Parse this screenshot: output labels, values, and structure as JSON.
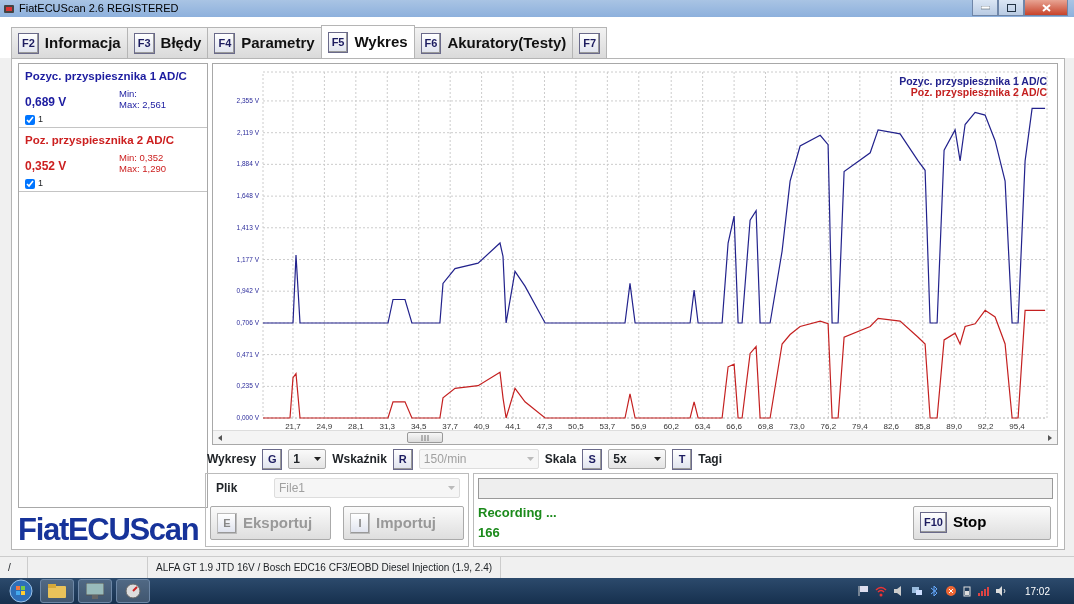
{
  "window": {
    "title": "FiatECUScan 2.6 REGISTERED"
  },
  "tabs": [
    {
      "key": "F2",
      "label": "Informacja",
      "selected": false
    },
    {
      "key": "F3",
      "label": "Błędy",
      "selected": false
    },
    {
      "key": "F4",
      "label": "Parametry",
      "selected": false
    },
    {
      "key": "F5",
      "label": "Wykres",
      "selected": true
    },
    {
      "key": "F6",
      "label": "Akuratory(Testy)",
      "selected": false
    },
    {
      "key": "F7",
      "selected": false
    }
  ],
  "signals": [
    {
      "name": "Pozyc. przyspiesznika 1 AD/C",
      "value": "0,689 V",
      "min": "Min:",
      "max": "Max: 2,561",
      "checkbox_label": "1",
      "checked": true,
      "color": "#1c1ca0"
    },
    {
      "name": "Poz. przyspiesznika 2 AD/C",
      "value": "0,352 V",
      "min": "Min: 0,352",
      "max": "Max: 1,290",
      "checkbox_label": "1",
      "checked": true,
      "color": "#cc2020"
    }
  ],
  "chart": {
    "chart_data": {
      "type": "line",
      "x": [
        18.65,
        21.4,
        21.7,
        22.01,
        22.42,
        31.37,
        31.88,
        33.1,
        33.81,
        36.66,
        36.97,
        38.19,
        40.54,
        42.77,
        43.08,
        43.39,
        44.3,
        45.32,
        47.36,
        55.5,
        56.01,
        56.52,
        62.12,
        62.53,
        62.94,
        65.38,
        65.99,
        66.6,
        67.01,
        67.42,
        68.23,
        68.84,
        69.25,
        70.27,
        71.49,
        72.3,
        73.32,
        75.36,
        76.17,
        76.58,
        77.19,
        77.8,
        80.45,
        81.26,
        83.5,
        85.33,
        86.04,
        86.55,
        87.26,
        87.98,
        89.1,
        89.6,
        90.11,
        91.13,
        92.15,
        93.17,
        94.19,
        94.9,
        95.51,
        96.22,
        96.93,
        98.26
      ],
      "series": [
        {
          "name": "Pozyc. przyspiesznika 1 AD/C",
          "color": "#22228c",
          "values": [
            0.706,
            0.706,
            0.706,
            1.21,
            0.706,
            0.706,
            0.88,
            0.88,
            0.706,
            0.706,
            1.0,
            1.11,
            1.15,
            1.3,
            1.2,
            0.706,
            1.09,
            0.98,
            0.706,
            0.706,
            1.0,
            0.706,
            0.706,
            0.95,
            0.706,
            0.706,
            1.3,
            1.5,
            0.706,
            0.706,
            1.47,
            1.54,
            0.706,
            0.706,
            1.24,
            1.76,
            2.02,
            2.1,
            2.03,
            0.706,
            0.706,
            1.83,
            1.97,
            2.14,
            2.11,
            1.91,
            1.84,
            0.706,
            0.706,
            1.99,
            2.14,
            1.91,
            2.18,
            2.27,
            2.25,
            2.06,
            1.76,
            0.706,
            0.706,
            1.91,
            2.3,
            2.3
          ]
        },
        {
          "name": "Poz. przyspiesznika 2 AD/C",
          "color": "#c42020",
          "values": [
            0,
            0,
            0.3,
            0.33,
            0,
            0,
            0.12,
            0.12,
            0,
            0,
            0.15,
            0.22,
            0.24,
            0.34,
            0.15,
            0,
            0.22,
            0.12,
            0,
            0,
            0.18,
            0,
            0,
            0.12,
            0,
            0,
            0.38,
            0.4,
            0,
            0,
            0.48,
            0.53,
            0,
            0,
            0.55,
            0.62,
            0.68,
            0.72,
            0.7,
            0,
            0,
            0.6,
            0.68,
            0.74,
            0.72,
            0.6,
            0.55,
            0,
            0,
            0.58,
            0.63,
            0.55,
            0.68,
            0.7,
            0.8,
            0.75,
            0.55,
            0,
            0,
            0.8,
            0.8,
            0.8
          ]
        }
      ],
      "grid": true,
      "xlim": [
        18.65,
        98.45
      ],
      "ylim": [
        0,
        2.57
      ],
      "xticks": [
        {
          "value": 21.7,
          "label": "21,7"
        },
        {
          "value": 24.9,
          "label": "24,9"
        },
        {
          "value": 28.1,
          "label": "28,1"
        },
        {
          "value": 31.3,
          "label": "31,3"
        },
        {
          "value": 34.5,
          "label": "34,5"
        },
        {
          "value": 37.7,
          "label": "37,7"
        },
        {
          "value": 40.9,
          "label": "40,9"
        },
        {
          "value": 44.1,
          "label": "44,1"
        },
        {
          "value": 47.3,
          "label": "47,3"
        },
        {
          "value": 50.5,
          "label": "50,5"
        },
        {
          "value": 53.7,
          "label": "53,7"
        },
        {
          "value": 56.9,
          "label": "56,9"
        },
        {
          "value": 60.2,
          "label": "60,2"
        },
        {
          "value": 63.4,
          "label": "63,4"
        },
        {
          "value": 66.6,
          "label": "66,6"
        },
        {
          "value": 69.8,
          "label": "69,8"
        },
        {
          "value": 73.0,
          "label": "73,0"
        },
        {
          "value": 76.2,
          "label": "76,2"
        },
        {
          "value": 79.4,
          "label": "79,4"
        },
        {
          "value": 82.6,
          "label": "82,6"
        },
        {
          "value": 85.8,
          "label": "85,8"
        },
        {
          "value": 89.0,
          "label": "89,0"
        },
        {
          "value": 92.2,
          "label": "92,2"
        },
        {
          "value": 95.4,
          "label": "95,4"
        }
      ],
      "yticks": [
        {
          "value": 0,
          "label": "0,000 V"
        },
        {
          "value": 0.235,
          "label": "0,235 V"
        },
        {
          "value": 0.471,
          "label": "0,471 V"
        },
        {
          "value": 0.706,
          "label": "0,706 V"
        },
        {
          "value": 0.942,
          "label": "0,942 V"
        },
        {
          "value": 1.177,
          "label": "1,177 V"
        },
        {
          "value": 1.413,
          "label": "1,413 V"
        },
        {
          "value": 1.648,
          "label": "1,648 V"
        },
        {
          "value": 1.884,
          "label": "1,884 V"
        },
        {
          "value": 2.119,
          "label": "2,119 V"
        },
        {
          "value": 2.355,
          "label": "2,355 V"
        }
      ]
    }
  },
  "controls": [
    {
      "kind": "select",
      "label": "Wykresy",
      "key": "G",
      "value": "1",
      "disabled": false
    },
    {
      "kind": "select",
      "label": "Wskaźnik",
      "key": "R",
      "value": "150/min",
      "disabled": true
    },
    {
      "kind": "select",
      "label": "Skala",
      "key": "S",
      "value": "5x",
      "disabled": false
    },
    {
      "kind": "toggle",
      "key": "T",
      "label": "Tagi"
    }
  ],
  "logo": "FiatECUScan",
  "file_panel": {
    "label": "Plik",
    "value": "File1",
    "disabled": true,
    "buttons": [
      {
        "key": "E",
        "label": "Eksportuj",
        "disabled": true
      },
      {
        "key": "I",
        "label": "Importuj",
        "disabled": true
      }
    ]
  },
  "recording": {
    "status": "Recording ...",
    "count": "166",
    "stop_button": {
      "key": "F10",
      "label": "Stop"
    }
  },
  "status_bar": [
    {
      "text": "/"
    },
    {
      "text": "ALFA GT 1.9 JTD 16V / Bosch EDC16 CF3/EOBD Diesel Injection (1.9, 2.4)"
    }
  ],
  "taskbar": {
    "time": "17:02"
  }
}
